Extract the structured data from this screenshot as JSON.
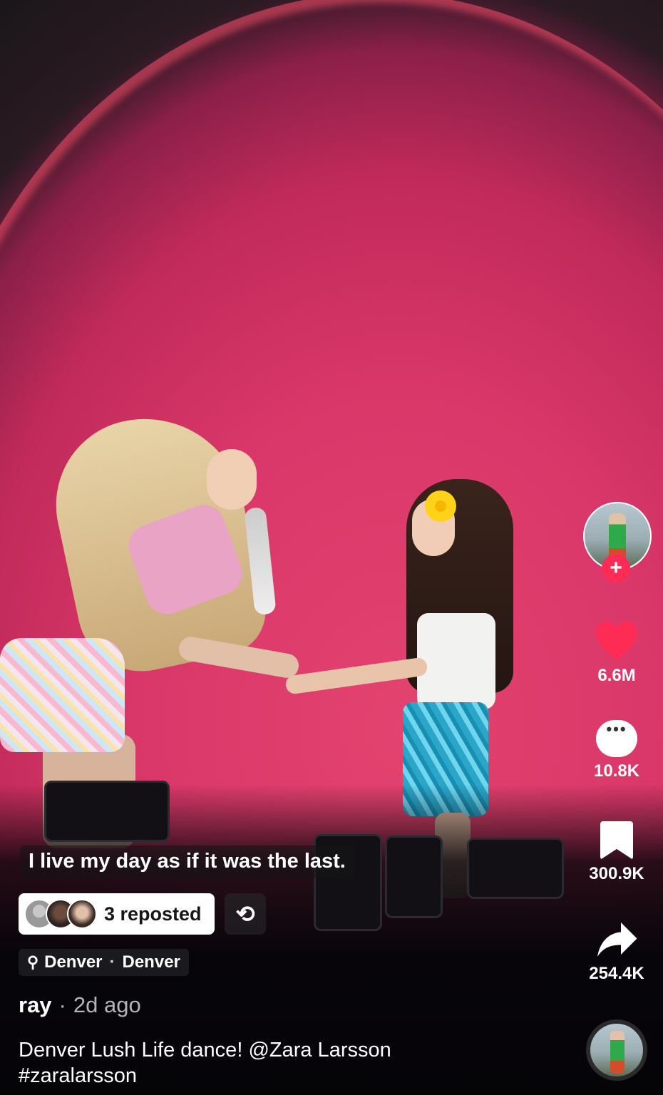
{
  "video": {
    "caption_overlay": "I live my day as if it was the last."
  },
  "repost": {
    "text": "3 reposted"
  },
  "location": {
    "city": "Denver",
    "region": "Denver"
  },
  "author": {
    "name": "ray",
    "time_ago": "2d ago"
  },
  "description": {
    "text": "Denver Lush Life dance!",
    "mention": "@Zara Larsson",
    "hashtag": "#zaralarsson"
  },
  "actions": {
    "likes": "6.6M",
    "comments": "10.8K",
    "saves": "300.9K",
    "shares": "254.4K"
  },
  "icons": {
    "follow": "plus-icon",
    "like": "heart-icon",
    "comment": "comment-icon",
    "save": "bookmark-icon",
    "share": "share-icon",
    "repost": "repost-icon",
    "location": "location-pin-icon"
  },
  "colors": {
    "accent": "#fe2c55",
    "background_pink": "#d93769"
  }
}
